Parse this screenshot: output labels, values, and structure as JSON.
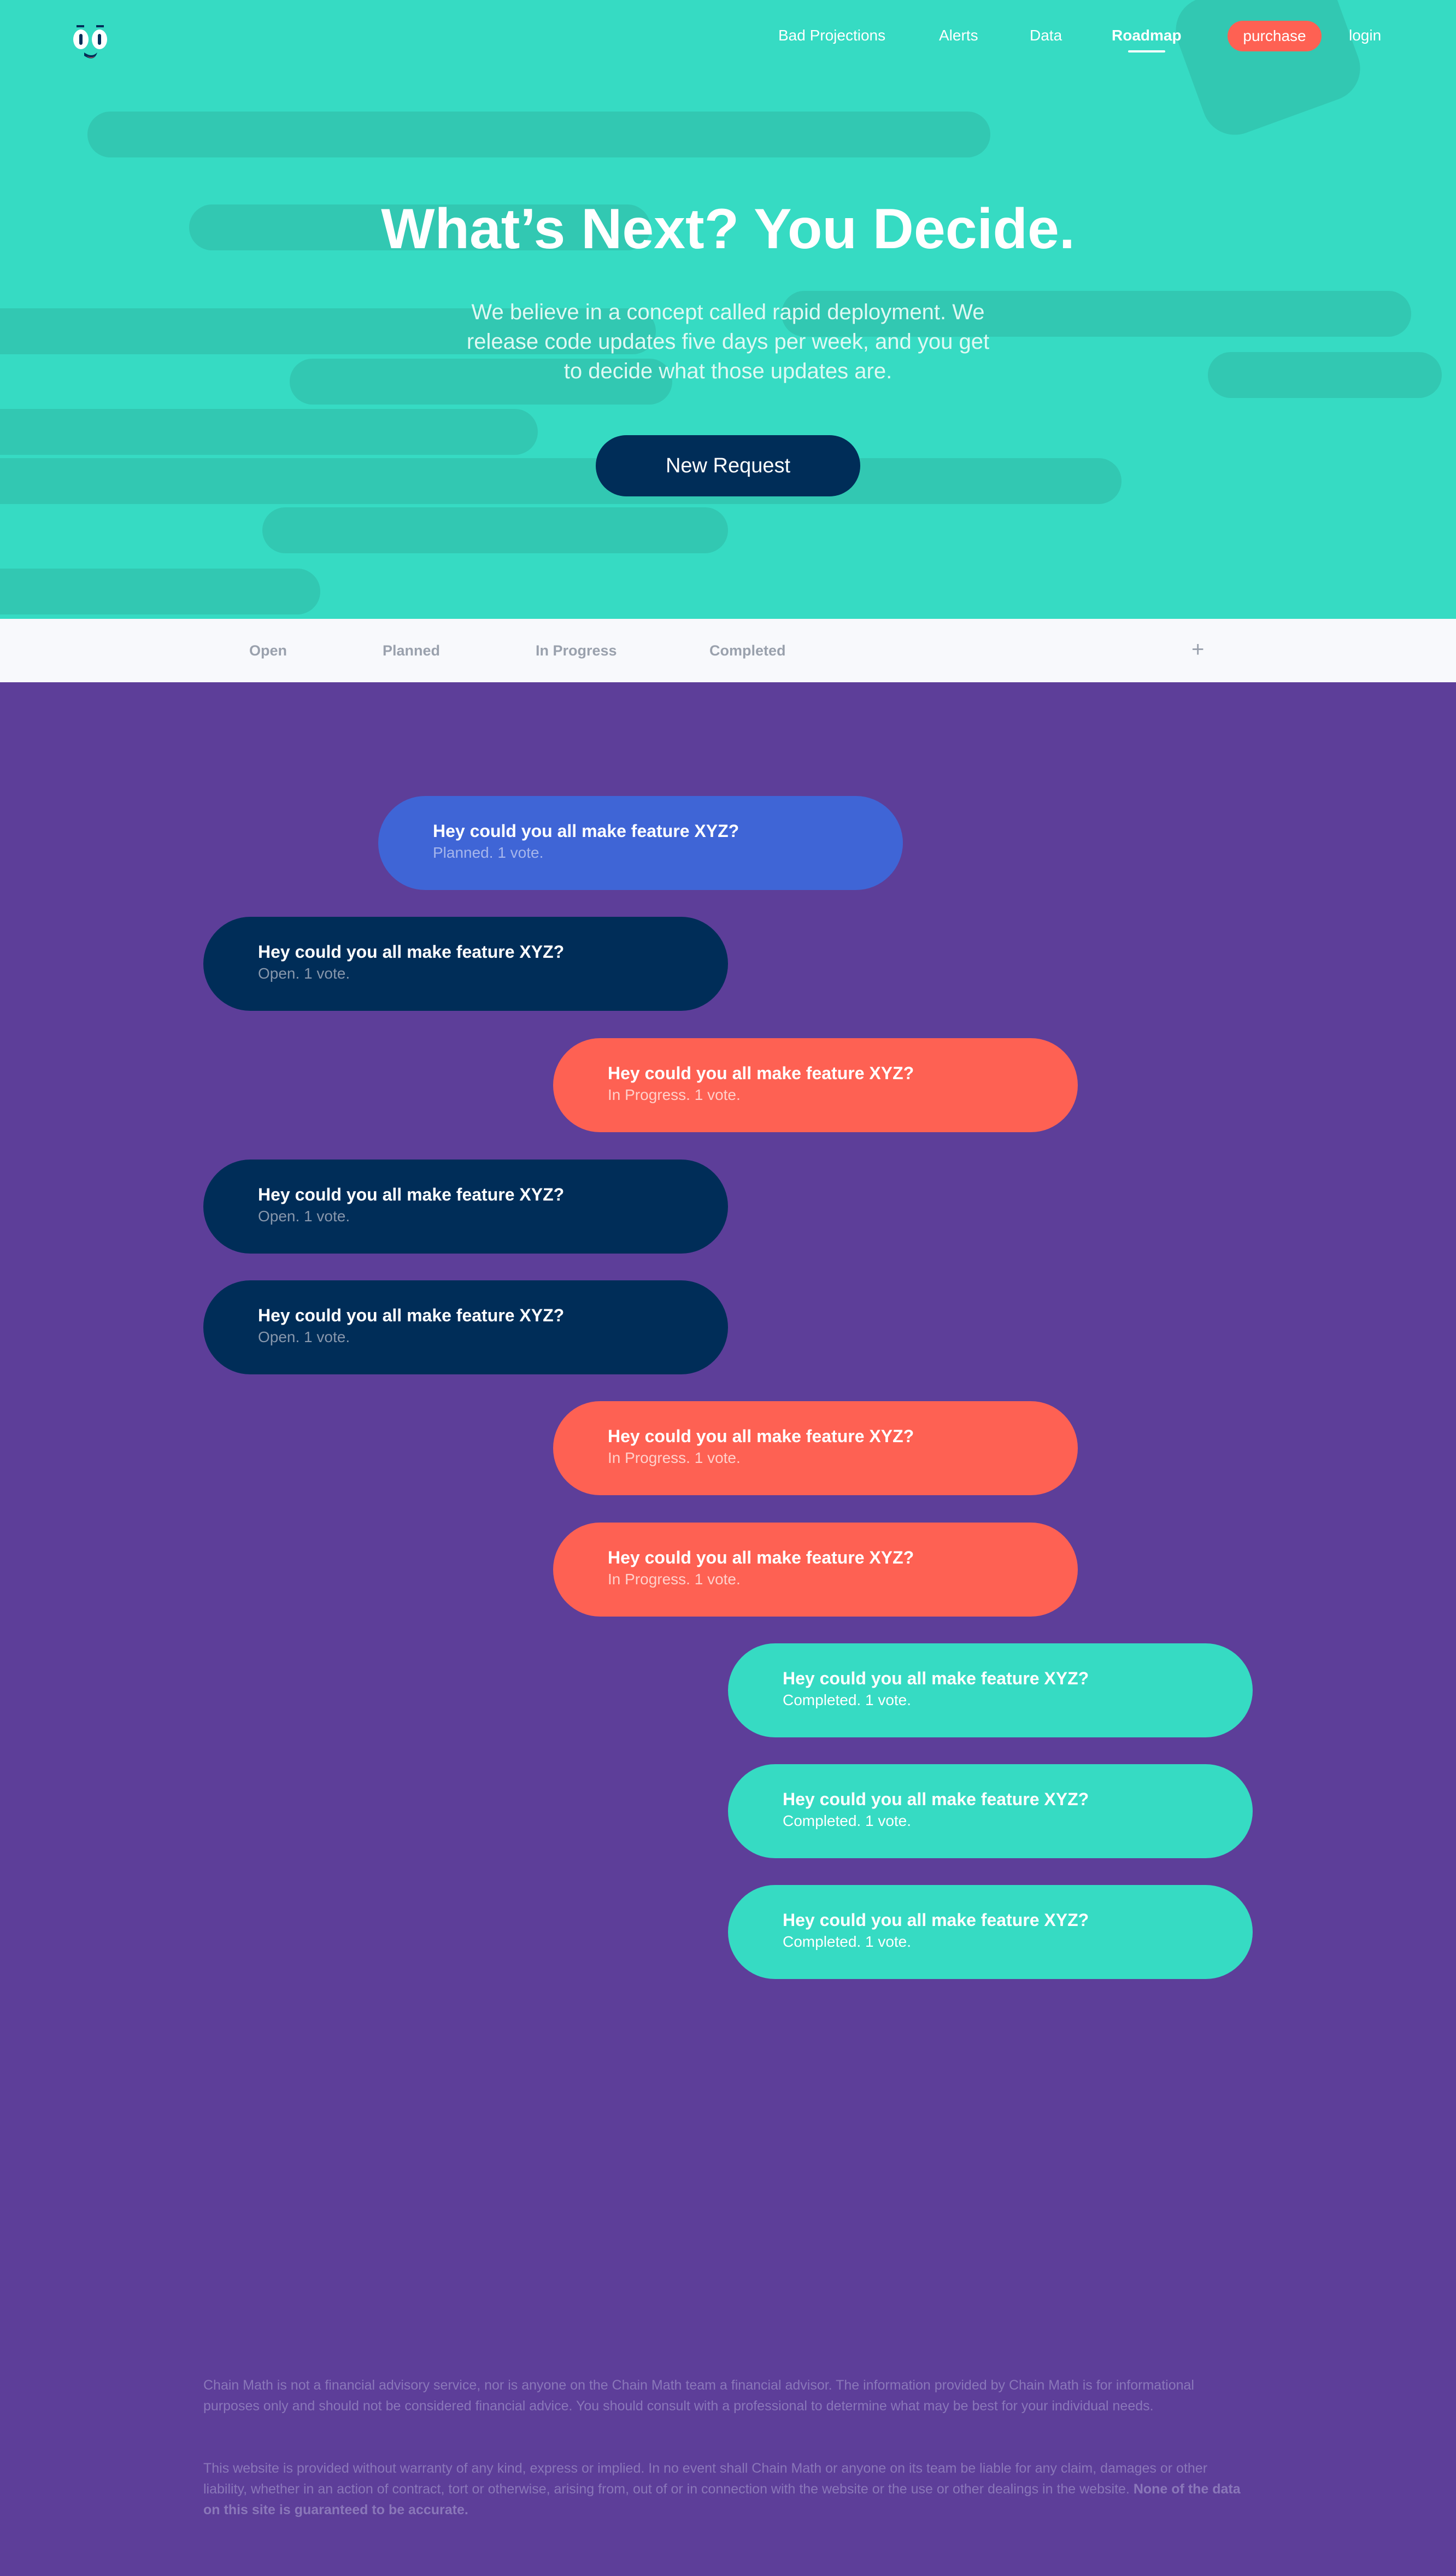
{
  "nav": {
    "items": [
      {
        "label": "Bad Projections",
        "active": false
      },
      {
        "label": "Alerts",
        "active": false
      },
      {
        "label": "Data",
        "active": false
      },
      {
        "label": "Roadmap",
        "active": true
      }
    ],
    "purchase_label": "purchase",
    "login_label": "login"
  },
  "hero": {
    "title": "What’s Next? You Decide.",
    "subtitle": "We believe in a concept called rapid deployment. We release code updates five days per week, and you get to decide what those updates are.",
    "button_label": "New Request"
  },
  "filters": {
    "tabs": [
      "Open",
      "Planned",
      "In Progress",
      "Completed"
    ],
    "add_label": "+"
  },
  "requests": [
    {
      "title": "Hey could you all make feature XYZ?",
      "meta": "Planned. 1 vote.",
      "status": "planned"
    },
    {
      "title": "Hey could you all make feature XYZ?",
      "meta": "Open. 1 vote.",
      "status": "open"
    },
    {
      "title": "Hey could you all make feature XYZ?",
      "meta": "In Progress. 1 vote.",
      "status": "in-progress"
    },
    {
      "title": "Hey could you all make feature XYZ?",
      "meta": "Open. 1 vote.",
      "status": "open"
    },
    {
      "title": "Hey could you all make feature XYZ?",
      "meta": "Open. 1 vote.",
      "status": "open"
    },
    {
      "title": "Hey could you all make feature XYZ?",
      "meta": "In Progress. 1 vote.",
      "status": "in-progress"
    },
    {
      "title": "Hey could you all make feature XYZ?",
      "meta": "In Progress. 1 vote.",
      "status": "in-progress"
    },
    {
      "title": "Hey could you all make feature XYZ?",
      "meta": "Completed. 1 vote.",
      "status": "completed"
    },
    {
      "title": "Hey could you all make feature XYZ?",
      "meta": "Completed. 1 vote.",
      "status": "completed"
    },
    {
      "title": "Hey could you all make feature XYZ?",
      "meta": "Completed. 1 vote.",
      "status": "completed"
    }
  ],
  "footer": {
    "disclaimer_1": "Chain Math is not a financial advisory service, nor is anyone on the Chain Math team a financial advisor. The information provided by Chain Math is for informational purposes only and should not be considered financial advice. You should consult with a professional to determine what may be best for your individual needs.",
    "disclaimer_2": "This website is provided without warranty of any kind, express or implied. In no event shall Chain Math or anyone on its team be liable for any claim, damages or other liability, whether in an action of contract, tort or otherwise, arising from, out of or in connection with the website or the use or other dealings in the website.",
    "disclaimer_2_bold": "None of the data on this site is guaranteed to be accurate."
  },
  "colors": {
    "hero_bg": "#36dbc3",
    "page_bg": "#5d3e99",
    "navy": "#002d58",
    "coral": "#fe6153",
    "blue": "#3f65d6",
    "teal": "#36dbc3"
  }
}
